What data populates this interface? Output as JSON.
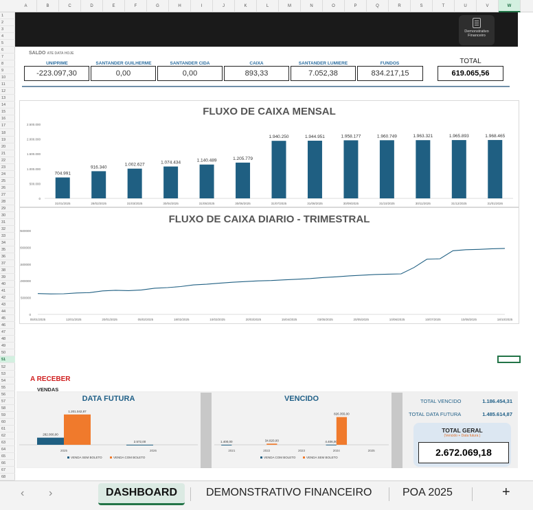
{
  "columns": [
    "A",
    "B",
    "C",
    "D",
    "E",
    "F",
    "G",
    "H",
    "I",
    "J",
    "K",
    "L",
    "M",
    "N",
    "O",
    "P",
    "Q",
    "R",
    "S",
    "T",
    "U",
    "V",
    "W"
  ],
  "selected_column": "W",
  "rows": [
    "1",
    "2",
    "3",
    "4",
    "5",
    "6",
    "7",
    "8",
    "9",
    "10",
    "11",
    "12",
    "13",
    "14",
    "15",
    "16",
    "17",
    "18",
    "19",
    "20",
    "21",
    "22",
    "23",
    "24",
    "25",
    "26",
    "27",
    "28",
    "29",
    "30",
    "31",
    "32",
    "33",
    "34",
    "35",
    "36",
    "37",
    "38",
    "39",
    "40",
    "41",
    "42",
    "43",
    "44",
    "45",
    "46",
    "47",
    "48",
    "49",
    "50",
    "51",
    "52",
    "53",
    "54",
    "55",
    "56",
    "57",
    "58",
    "59",
    "60",
    "61",
    "62",
    "63",
    "64",
    "65",
    "66",
    "67",
    "68"
  ],
  "selected_row": "51",
  "demo_button": {
    "label_line1": "Demonstrativo",
    "label_line2": "Financeiro"
  },
  "saldo": {
    "label": "SALDO",
    "sublabel": "ATE DATA HOJE",
    "accounts": [
      {
        "name": "UNIPRIME",
        "value": "-223.097,30"
      },
      {
        "name": "SANTANDER GUILHERME",
        "value": "0,00"
      },
      {
        "name": "SANTANDER CIDA",
        "value": "0,00"
      },
      {
        "name": "CAIXA",
        "value": "893,33"
      },
      {
        "name": "SANTANDER LUMIERE",
        "value": "7.052,38"
      },
      {
        "name": "FUNDOS",
        "value": "834.217,15"
      }
    ],
    "total_label": "TOTAL",
    "total_value": "619.065,56"
  },
  "chart_data": [
    {
      "type": "bar",
      "title": "FLUXO DE CAIXA MENSAL",
      "categories": [
        "31/01/2025",
        "28/02/2025",
        "31/03/2025",
        "30/04/2025",
        "31/05/2025",
        "30/06/2025",
        "31/07/2025",
        "31/08/2025",
        "30/09/2025",
        "31/10/2025",
        "30/11/2025",
        "31/12/2025",
        "31/01/2026"
      ],
      "values": [
        704991,
        916340,
        1002627,
        1074434,
        1140489,
        1205779,
        1940250,
        1944951,
        1958177,
        1960749,
        1963321,
        1965893,
        1968465
      ],
      "data_labels": [
        "704.991",
        "916.340",
        "1.002.627",
        "1.074.434",
        "1.140.489",
        "1.205.779",
        "1.940.250",
        "1.944.951",
        "1.958.177",
        "1.960.749",
        "1.963.321",
        "1.965.893",
        "1.968.465"
      ],
      "y_ticks": [
        "0",
        "500.000",
        "1.000.000",
        "1.500.000",
        "2.000.000",
        "2.500.000"
      ],
      "ylim": [
        0,
        2500000
      ],
      "color": "#1f5f82",
      "grid": false
    },
    {
      "type": "line",
      "title": "FLUXO DE CAIXA DIARIO - TRIMESTRAL",
      "x": [
        "05/01/2025",
        "12/01/2025",
        "20/01/2025",
        "28/01/2025",
        "05/02/2025",
        "12/02/2025",
        "18/02/2025",
        "25/02/2025",
        "05/03/2025",
        "12/03/2025",
        "20/03/2025",
        "28/03/2025",
        "05/04/2025",
        "10/04/2025",
        "15/04/2025",
        "22/04/2025",
        "03/05/2025",
        "10/05/2025",
        "20/05/2025",
        "30/05/2025",
        "10/06/2025",
        "20/06/2025",
        "01/07/2025",
        "05/07/2025",
        "10/07/2025",
        "15/07/2025",
        "20/07/2025",
        "01/08/2025",
        "10/08/2025",
        "20/08/2025",
        "01/09/2025",
        "10/09/2025",
        "20/09/2025",
        "01/10/2025",
        "10/10/2025",
        "18/10/2025",
        "25/10/2025"
      ],
      "values": [
        620000,
        610000,
        615000,
        640000,
        650000,
        700000,
        720000,
        710000,
        730000,
        780000,
        800000,
        830000,
        880000,
        900000,
        930000,
        960000,
        980000,
        1000000,
        1010000,
        1030000,
        1050000,
        1070000,
        1100000,
        1120000,
        1150000,
        1170000,
        1190000,
        1200000,
        1210000,
        1400000,
        1650000,
        1660000,
        1900000,
        1930000,
        1940000,
        1960000,
        1970000
      ],
      "x_ticks": [
        "05/01/2025",
        "12/01/2025",
        "20/01/2025",
        "05/02/2025",
        "18/02/2025",
        "10/03/2025",
        "20/03/2025",
        "15/04/2025",
        "03/05/2025",
        "20/05/2025",
        "10/06/2025",
        "10/07/2025",
        "10/08/2025",
        "18/10/2025"
      ],
      "y_ticks": [
        "0",
        "500000",
        "1000000",
        "1500000",
        "2000000",
        "2500000"
      ],
      "ylim": [
        0,
        2500000
      ],
      "color": "#1f5f82",
      "grid": false
    },
    {
      "type": "bar",
      "title": "DATA FUTURA",
      "categories": [
        "2025",
        "2026"
      ],
      "series": [
        {
          "name": "VENDA SEM BOLETO",
          "values": [
            282000,
            2572
          ],
          "labels": [
            "282.000,00",
            "2.572,00"
          ],
          "color": "#1f5f82"
        },
        {
          "name": "VENDA COM BOLETO",
          "values": [
            1201042.87,
            0
          ],
          "labels": [
            "1.201.042,87",
            ""
          ],
          "color": "#f07a2c"
        }
      ],
      "legend": "bottom"
    },
    {
      "type": "bar",
      "title": "VENCIDO",
      "categories": [
        "2021",
        "2022",
        "2023",
        "2024",
        "2025"
      ],
      "series": [
        {
          "name": "VENDA COM BOLETO",
          "values": [
            1400,
            0,
            0,
            4406,
            0
          ],
          "labels": [
            "1.400,00",
            "",
            "",
            "4.406,00",
            ""
          ],
          "color": "#1f5f82"
        },
        {
          "name": "VENDA SEM BOLETO",
          "values": [
            0,
            34820,
            0,
            826355,
            0
          ],
          "labels": [
            "",
            "34.820,00",
            "",
            "826.355,00",
            ""
          ],
          "color": "#f07a2c"
        }
      ],
      "legend": "bottom"
    }
  ],
  "receber": {
    "title": "A RECEBER",
    "subtitle": "VENDAS",
    "total_vencido_label": "TOTAL VENCIDO",
    "total_vencido_value": "1.186.454,31",
    "total_futura_label": "TOTAL DATA FUTURA",
    "total_futura_value": "1.485.614,87",
    "total_geral_label": "TOTAL GERAL",
    "total_geral_sub": "(Vencido + Data futura )",
    "total_geral_value": "2.672.069,18"
  },
  "tabs": {
    "nav_prev": "‹",
    "nav_next": "›",
    "items": [
      "DASHBOARD",
      "DEMONSTRATIVO FINANCEIRO",
      "POA 2025"
    ],
    "active": "DASHBOARD",
    "add": "+"
  }
}
